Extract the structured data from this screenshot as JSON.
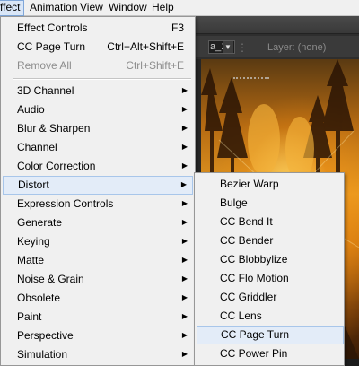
{
  "menubar": {
    "items": [
      {
        "label": "ffect"
      },
      {
        "label": "Animation"
      },
      {
        "label": "View"
      },
      {
        "label": "Window"
      },
      {
        "label": "Help"
      }
    ]
  },
  "background": {
    "comp_select_value": "a_1",
    "layer_label": "Layer: (none)"
  },
  "effect_menu": {
    "items": [
      {
        "label": "Effect Controls",
        "shortcut": "F3"
      },
      {
        "label": "CC Page Turn",
        "shortcut": "Ctrl+Alt+Shift+E"
      },
      {
        "label": "Remove All",
        "shortcut": "Ctrl+Shift+E"
      },
      {
        "label": "3D Channel"
      },
      {
        "label": "Audio"
      },
      {
        "label": "Blur & Sharpen"
      },
      {
        "label": "Channel"
      },
      {
        "label": "Color Correction"
      },
      {
        "label": "Distort"
      },
      {
        "label": "Expression Controls"
      },
      {
        "label": "Generate"
      },
      {
        "label": "Keying"
      },
      {
        "label": "Matte"
      },
      {
        "label": "Noise & Grain"
      },
      {
        "label": "Obsolete"
      },
      {
        "label": "Paint"
      },
      {
        "label": "Perspective"
      },
      {
        "label": "Simulation"
      }
    ]
  },
  "distort_menu": {
    "items": [
      {
        "label": "Bezier Warp"
      },
      {
        "label": "Bulge"
      },
      {
        "label": "CC Bend It"
      },
      {
        "label": "CC Bender"
      },
      {
        "label": "CC Blobbylize"
      },
      {
        "label": "CC Flo Motion"
      },
      {
        "label": "CC Griddler"
      },
      {
        "label": "CC Lens"
      },
      {
        "label": "CC Page Turn"
      },
      {
        "label": "CC Power Pin"
      }
    ]
  },
  "colors": {
    "menu_bg": "#f0f0f0",
    "highlight_bg": "#e3ecf8",
    "highlight_border": "#a8c6ea",
    "disabled_text": "#8d8d8d",
    "app_dark": "#262626"
  }
}
